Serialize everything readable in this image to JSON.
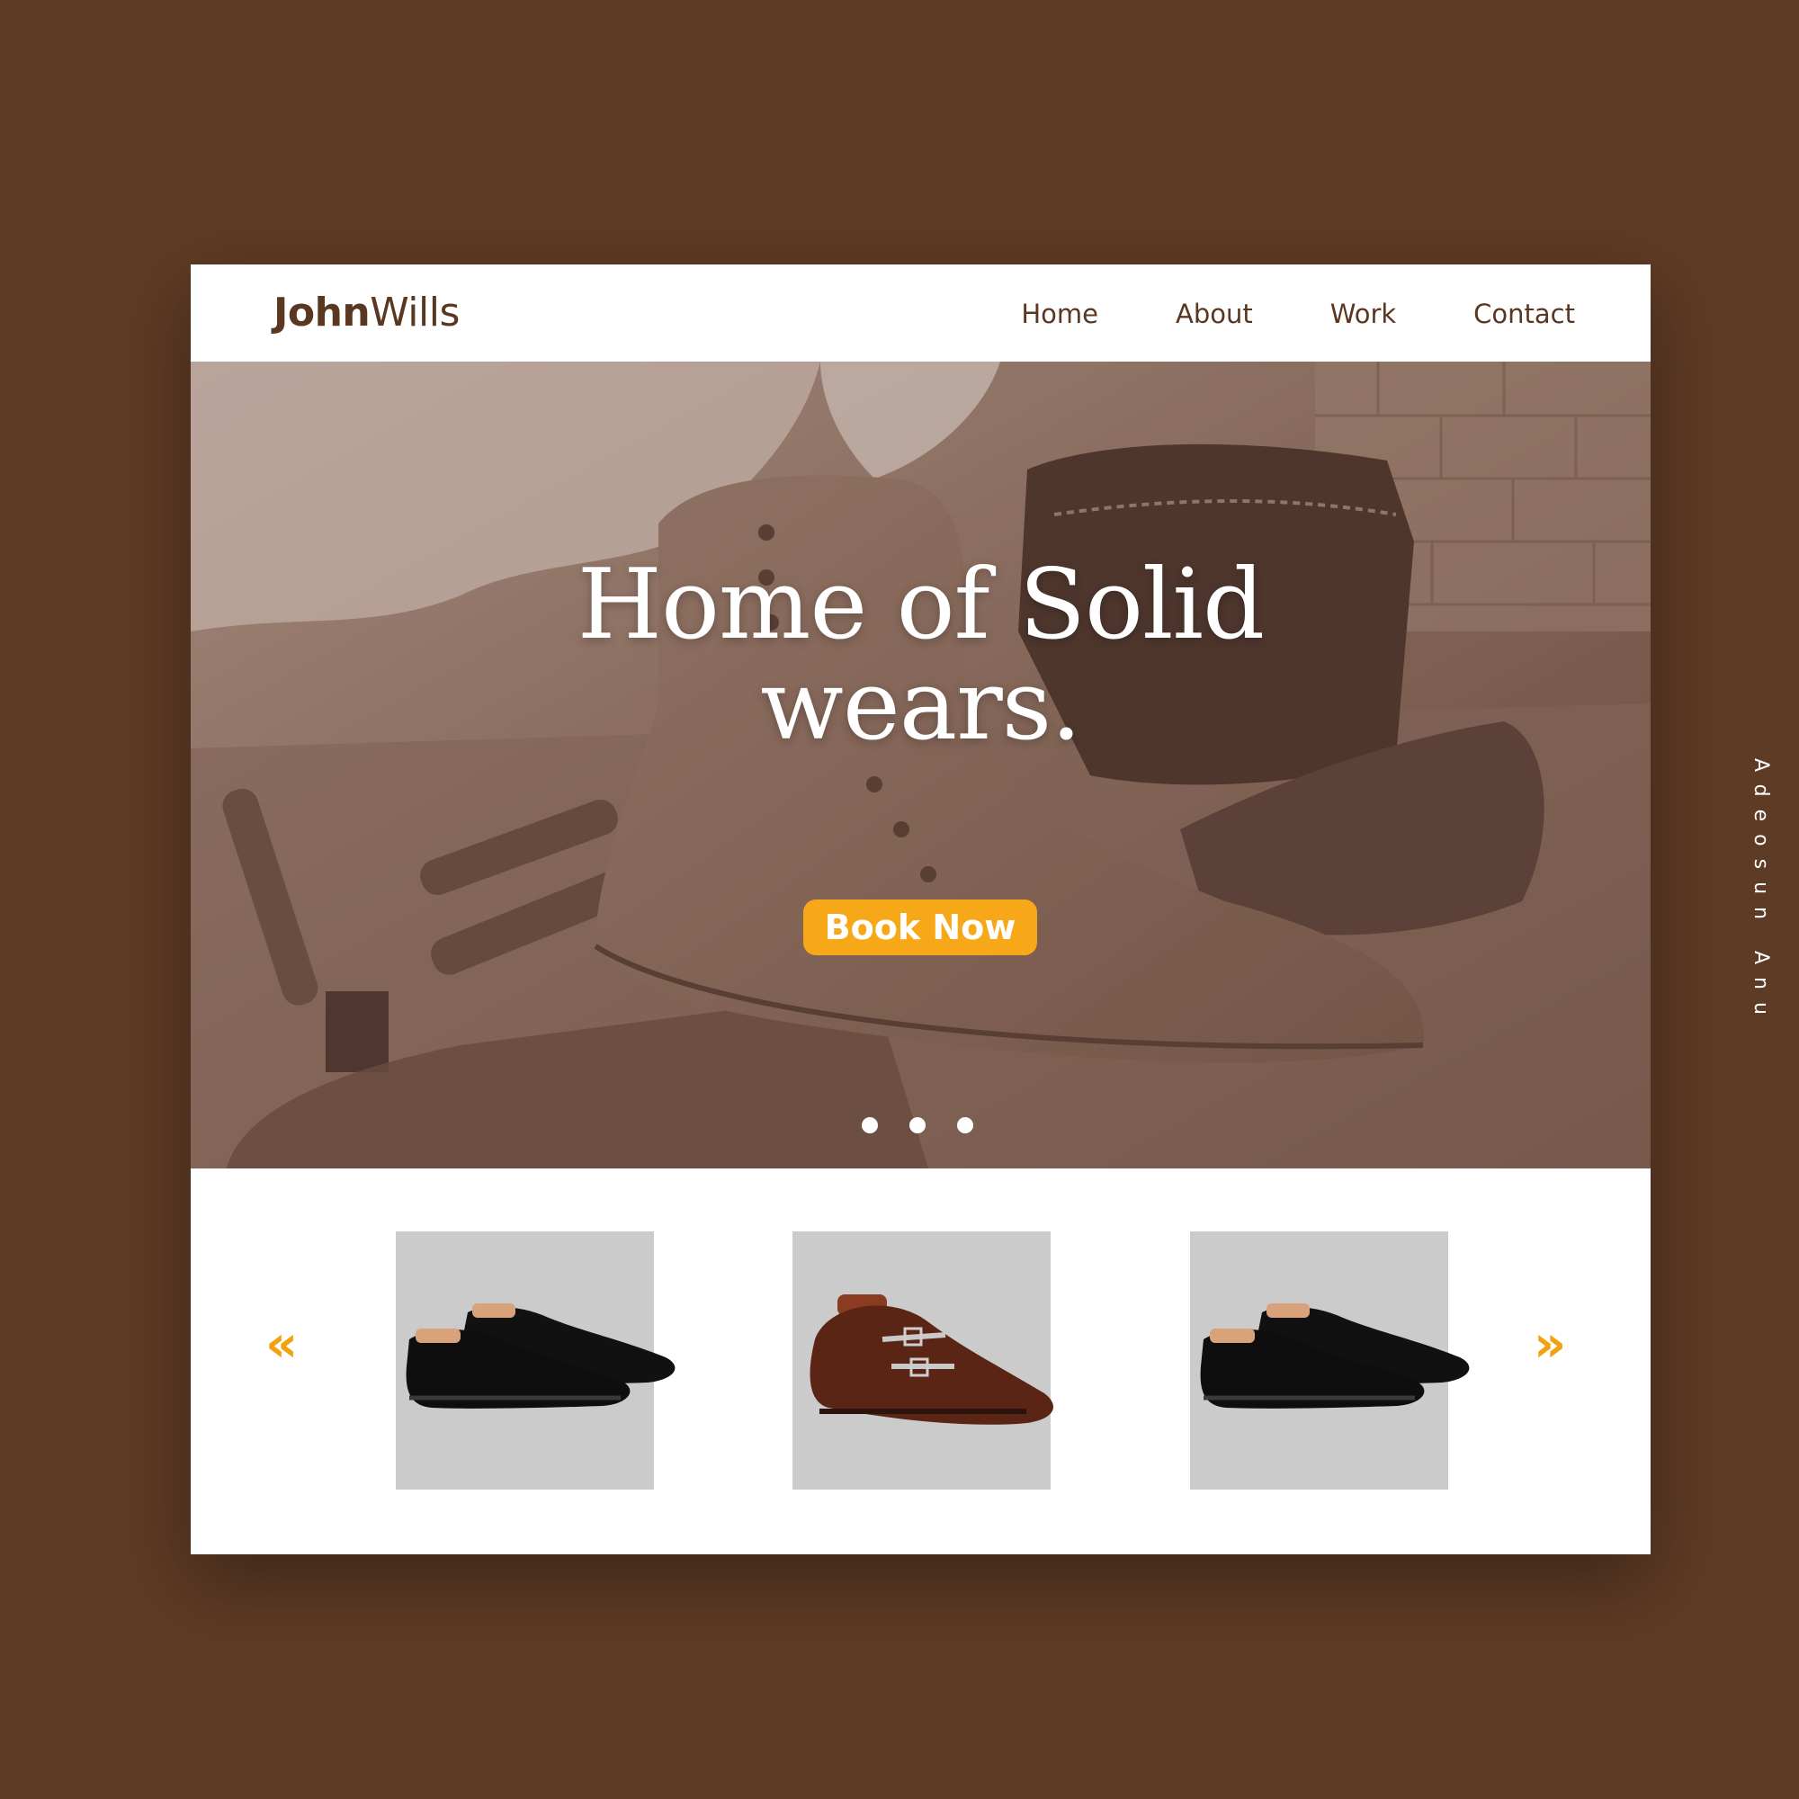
{
  "brand": {
    "bold": "John",
    "light": "Wills"
  },
  "nav": {
    "items": [
      {
        "label": "Home"
      },
      {
        "label": "About"
      },
      {
        "label": "Work"
      },
      {
        "label": "Contact"
      }
    ]
  },
  "hero": {
    "title_line1": "Home of Solid",
    "title_line2": "wears.",
    "cta_label": "Book Now",
    "carousel_dots": 3
  },
  "products": {
    "prev_arrow": "«",
    "next_arrow": "»",
    "items": [
      {
        "shoe": "black-oxford-shoe"
      },
      {
        "shoe": "brown-monk-strap-shoe"
      },
      {
        "shoe": "black-oxford-shoe"
      }
    ]
  },
  "credit": "Adeosun Anu",
  "colors": {
    "background": "#5e3b25",
    "accent": "#f7a818",
    "brand_text": "#5a3720",
    "card_bg": "#cbcbcb"
  }
}
